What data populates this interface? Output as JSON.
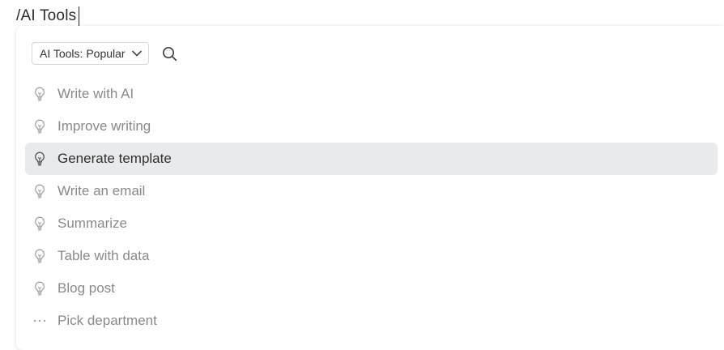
{
  "editor": {
    "command_text": "/AI Tools"
  },
  "toolbar": {
    "dropdown_label": "AI Tools: Popular",
    "dropdown_icon": "chevron-down-icon",
    "search_icon": "search-icon"
  },
  "items": [
    {
      "label": "Write with AI",
      "icon": "lightbulb-icon",
      "active": false
    },
    {
      "label": "Improve writing",
      "icon": "lightbulb-icon",
      "active": false
    },
    {
      "label": "Generate template",
      "icon": "lightbulb-icon",
      "active": true
    },
    {
      "label": "Write an email",
      "icon": "lightbulb-icon",
      "active": false
    },
    {
      "label": "Summarize",
      "icon": "lightbulb-icon",
      "active": false
    },
    {
      "label": "Table with data",
      "icon": "lightbulb-icon",
      "active": false
    },
    {
      "label": "Blog post",
      "icon": "lightbulb-icon",
      "active": false
    },
    {
      "label": "Pick department",
      "icon": "more-horizontal-icon",
      "active": false
    }
  ],
  "colors": {
    "active_background": "#e9eaec",
    "muted_text": "#8a8a8a",
    "active_text": "#2f2f2f"
  }
}
